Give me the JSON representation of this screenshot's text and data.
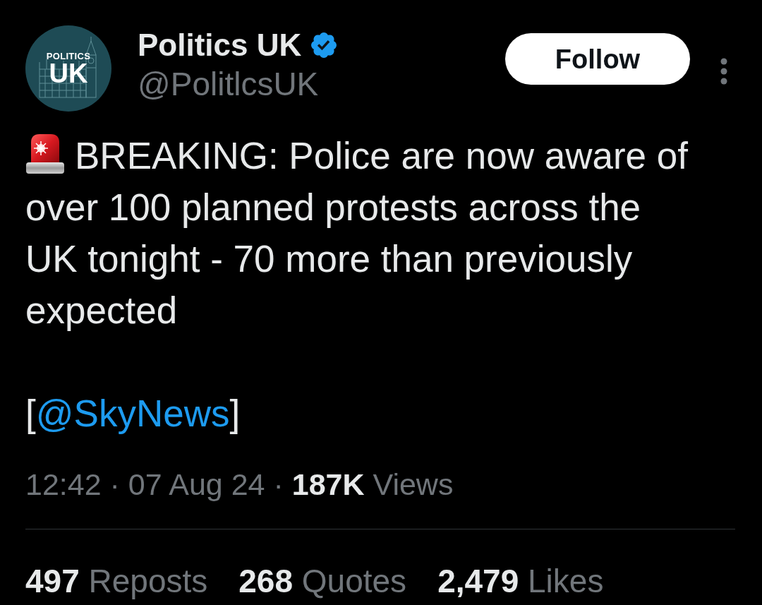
{
  "account": {
    "avatar": {
      "line_1": "POLITICS",
      "line_2": "UK"
    },
    "name": "Politics UK",
    "verified": true,
    "handle": "@PolitlcsUK"
  },
  "follow_button": {
    "label": "Follow"
  },
  "post": {
    "text": "BREAKING: Police are now aware of over 100 planned protests across the UK tonight - 70 more than previously expected",
    "source": {
      "open": "[",
      "mention": "@SkyNews",
      "close": "]"
    }
  },
  "meta": "12:42 · 07 Aug 24 · **187K** Views",
  "stats": [
    {
      "count": "497",
      "label": "Reposts"
    },
    {
      "count": "268",
      "label": "Quotes"
    },
    {
      "count": "2,479",
      "label": "Likes"
    }
  ]
}
